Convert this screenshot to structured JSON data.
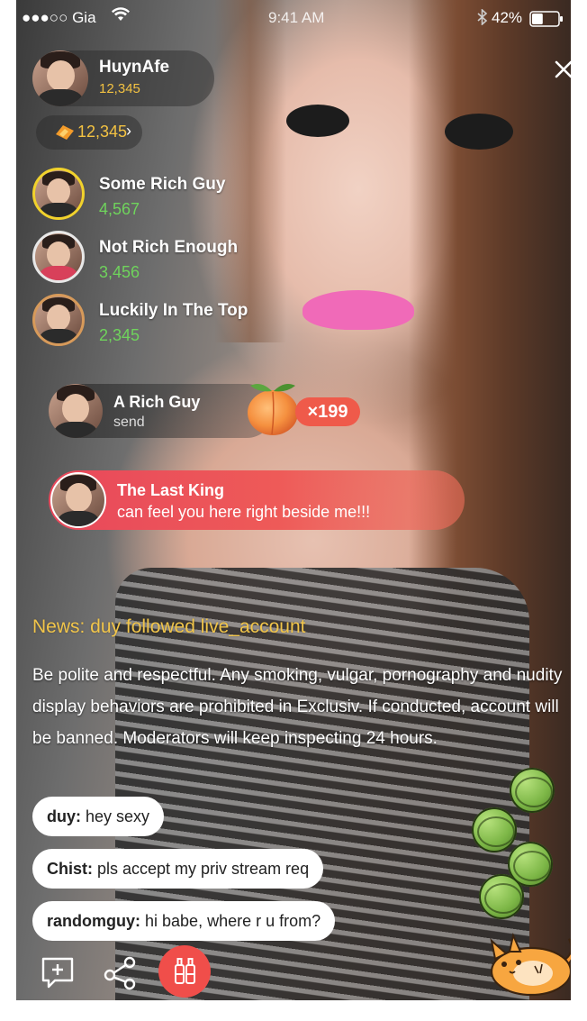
{
  "status_bar": {
    "carrier": "●●●○○ Gia",
    "wifi_icon": "wifi-icon",
    "time": "9:41 AM",
    "bluetooth_icon": "bluetooth-icon",
    "battery": "42%",
    "battery_level": 0.42
  },
  "host": {
    "name": "HuynAfe",
    "followers": "12,345"
  },
  "coins": {
    "amount": "12,345",
    "chevron": "›"
  },
  "top_viewers": [
    {
      "name": "Some Rich Guy",
      "score": "4,567"
    },
    {
      "name": "Not Rich Enough",
      "score": "3,456"
    },
    {
      "name": "Luckily In The Top",
      "score": "2,345"
    }
  ],
  "gift": {
    "sender": "A Rich Guy",
    "action": "send",
    "multiplier": "×199",
    "icon": "peach-icon"
  },
  "vip_message": {
    "name": "The Last King",
    "text": "can feel you here right beside me!!!"
  },
  "news": "News: duy followed live_account",
  "rules": "Be polite and respectful. Any smoking, vulgar, pornography and nudity display behaviors are prohibited in Exclusiv. If conducted, account will be banned. Moderators will keep inspecting 24 hours.",
  "chat": [
    {
      "user": "duy:",
      "message": " hey sexy"
    },
    {
      "user": "Chist:",
      "message": " pls accept my priv stream req"
    },
    {
      "user": "randomguy:",
      "message": " hi babe, where r u from?"
    }
  ],
  "colors": {
    "accent_red": "#f04e4a",
    "gold": "#f3c242",
    "green": "#6fd35c"
  }
}
